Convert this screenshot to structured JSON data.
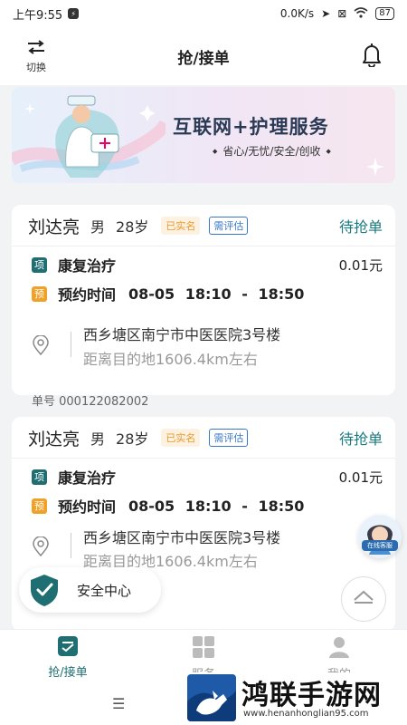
{
  "status_bar": {
    "time": "上午9:55",
    "network": "0.0K/s",
    "battery": "87"
  },
  "header": {
    "switch_label": "切换",
    "title": "抢/接单"
  },
  "banner": {
    "title": "互联网+护理服务",
    "subtitle": "省心/无忧/安全/创收"
  },
  "orders": [
    {
      "name": "刘达亮",
      "gender": "男",
      "age": "28岁",
      "tag_verified": "已实名",
      "tag_assess": "需评估",
      "status": "待抢单",
      "service_badge": "项",
      "service": "康复治疗",
      "price": "0.01元",
      "appt_badge": "预",
      "appt_label": "预约时间",
      "appt_value": "08-05 18:10 - 18:50",
      "address": "西乡塘区南宁市中医医院3号楼",
      "distance": "距离目的地1606.4km左右",
      "order_no": "单号 000122082002"
    },
    {
      "name": "刘达亮",
      "gender": "男",
      "age": "28岁",
      "tag_verified": "已实名",
      "tag_assess": "需评估",
      "status": "待抢单",
      "service_badge": "项",
      "service": "康复治疗",
      "price": "0.01元",
      "appt_badge": "预",
      "appt_label": "预约时间",
      "appt_value": "08-05 18:10 - 18:50",
      "address": "西乡塘区南宁市中医医院3号楼",
      "distance": "距离目的地1606.4km左右"
    }
  ],
  "floating": {
    "safety_center": "安全中心",
    "customer_service": "在线客服"
  },
  "tabbar": {
    "tab1": "抢/接单",
    "tab2": "服务",
    "tab3": "我的"
  },
  "watermark": {
    "text": "鸿联手游网",
    "url": "www.henanhonglian95.com"
  },
  "colors": {
    "accent": "#1f6e72",
    "service_badge": "#1f6e72",
    "appt_badge": "#f0a127",
    "verified": "#e89a2a",
    "assess": "#3a78c7"
  }
}
